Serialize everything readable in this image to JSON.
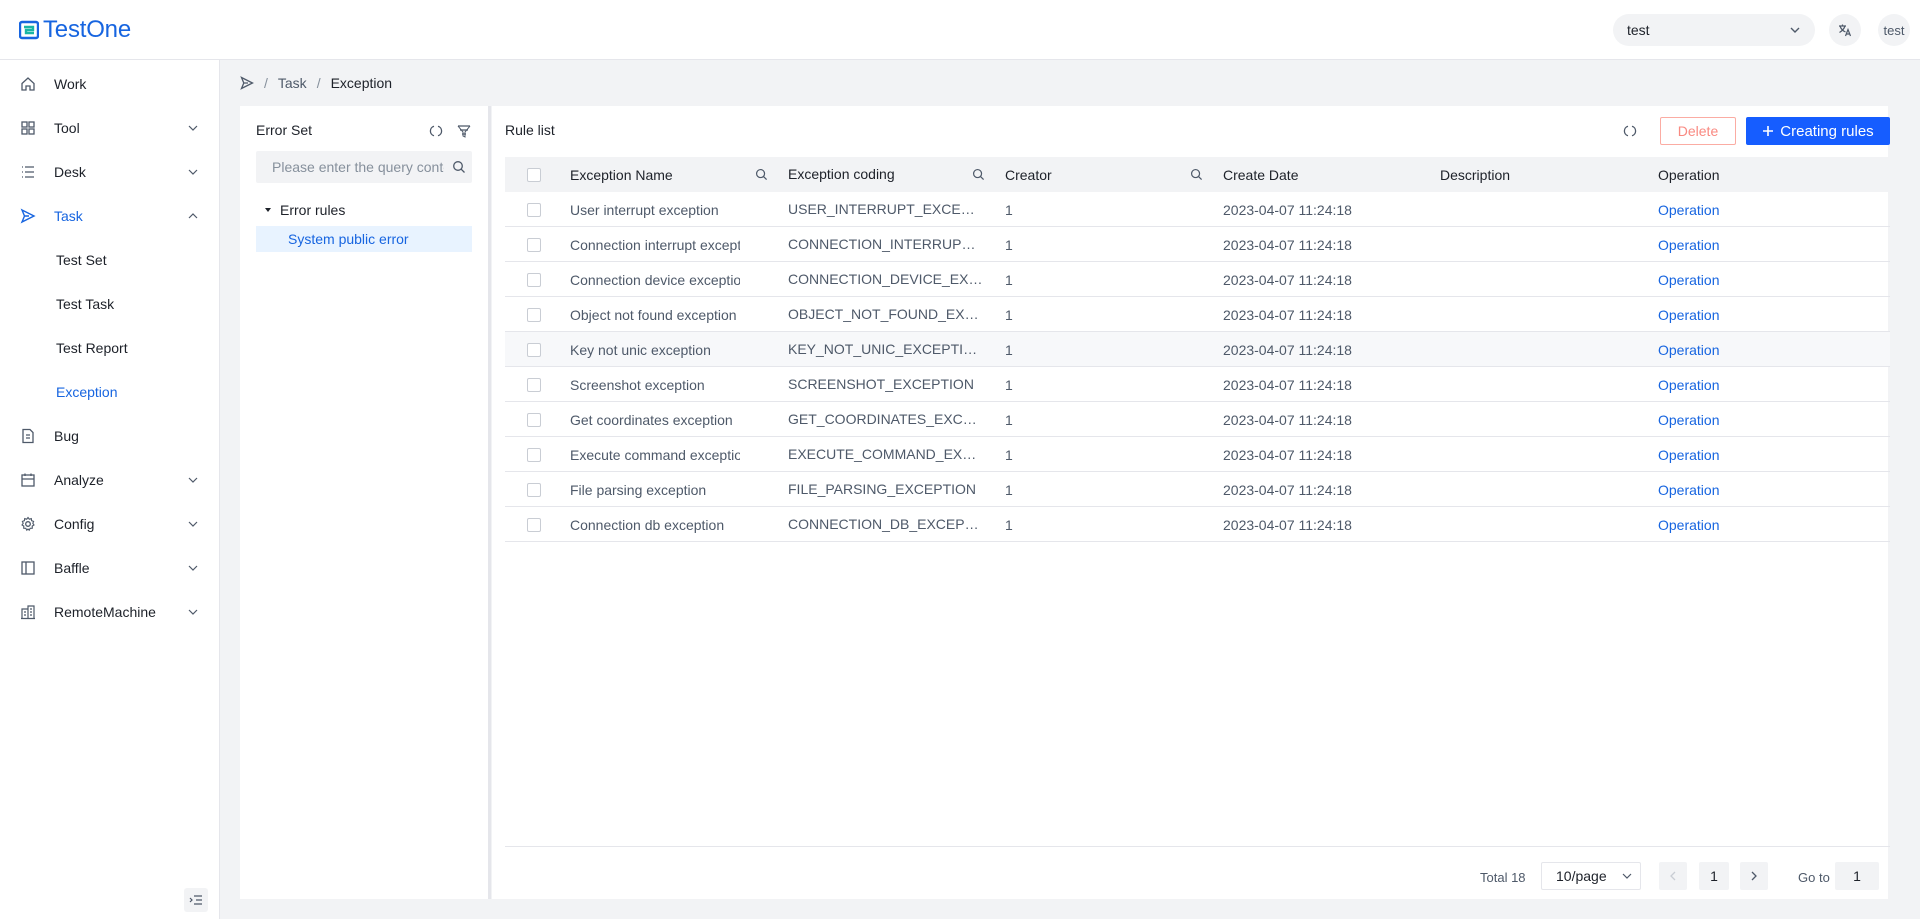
{
  "app": {
    "logo_text": "TestOne"
  },
  "topbar": {
    "project_value": "test",
    "lang_icon": "translate-icon",
    "user": "test"
  },
  "sidebar": {
    "items": [
      {
        "label": "Work",
        "icon": "home-icon"
      },
      {
        "label": "Tool",
        "icon": "grid-icon"
      },
      {
        "label": "Desk",
        "icon": "list-icon"
      },
      {
        "label": "Task",
        "icon": "send-icon"
      },
      {
        "label": "Bug",
        "icon": "document-icon"
      },
      {
        "label": "Analyze",
        "icon": "calendar-icon"
      },
      {
        "label": "Config",
        "icon": "gear-icon"
      },
      {
        "label": "Baffle",
        "icon": "layout-icon"
      },
      {
        "label": "RemoteMachine",
        "icon": "building-icon"
      }
    ],
    "task_children": [
      "Test Set",
      "Test Task",
      "Test Report",
      "Exception"
    ],
    "active_item": "Task",
    "selected_child": "Exception"
  },
  "breadcrumb": {
    "level1": "Task",
    "level2": "Exception"
  },
  "error_set": {
    "title": "Error Set",
    "search_placeholder": "Please enter the query content",
    "tree": {
      "root": "Error rules",
      "child": "System public error"
    }
  },
  "rule_list": {
    "title": "Rule list",
    "delete_label": "Delete",
    "create_label": "Creating rules",
    "columns": [
      "Exception Name",
      "Exception coding",
      "Creator",
      "Create Date",
      "Description",
      "Operation"
    ],
    "rows": [
      {
        "name": "User interrupt exception",
        "code": "USER_INTERRUPT_EXCEPTION",
        "creator": "1",
        "date": "2023-04-07 11:24:18",
        "description": "",
        "operation": "Operation"
      },
      {
        "name": "Connection interrupt exception",
        "code": "CONNECTION_INTERRUPT_EXCEPTION",
        "creator": "1",
        "date": "2023-04-07 11:24:18",
        "description": "",
        "operation": "Operation"
      },
      {
        "name": "Connection device exception",
        "code": "CONNECTION_DEVICE_EXCEPTION",
        "creator": "1",
        "date": "2023-04-07 11:24:18",
        "description": "",
        "operation": "Operation"
      },
      {
        "name": "Object not found exception",
        "code": "OBJECT_NOT_FOUND_EXCEPTION",
        "creator": "1",
        "date": "2023-04-07 11:24:18",
        "description": "",
        "operation": "Operation"
      },
      {
        "name": "Key not unic exception",
        "code": "KEY_NOT_UNIC_EXCEPTION",
        "creator": "1",
        "date": "2023-04-07 11:24:18",
        "description": "",
        "operation": "Operation"
      },
      {
        "name": "Screenshot exception",
        "code": "SCREENSHOT_EXCEPTION",
        "creator": "1",
        "date": "2023-04-07 11:24:18",
        "description": "",
        "operation": "Operation"
      },
      {
        "name": "Get coordinates exception",
        "code": "GET_COORDINATES_EXCEPTION",
        "creator": "1",
        "date": "2023-04-07 11:24:18",
        "description": "",
        "operation": "Operation"
      },
      {
        "name": "Execute command exception",
        "code": "EXECUTE_COMMAND_EXCEPTION",
        "creator": "1",
        "date": "2023-04-07 11:24:18",
        "description": "",
        "operation": "Operation"
      },
      {
        "name": "File parsing exception",
        "code": "FILE_PARSING_EXCEPTION",
        "creator": "1",
        "date": "2023-04-07 11:24:18",
        "description": "",
        "operation": "Operation"
      },
      {
        "name": "Connection db exception",
        "code": "CONNECTION_DB_EXCEPTION",
        "creator": "1",
        "date": "2023-04-07 11:24:18",
        "description": "",
        "operation": "Operation"
      }
    ]
  },
  "pagination": {
    "total_label": "Total 18",
    "page_size": "10/page",
    "current_page": "1",
    "goto_label": "Go to",
    "goto_value": "1"
  },
  "colors": {
    "primary": "#165DFF",
    "link": "#1765E0",
    "danger_text": "#F98981",
    "selected_bg": "#E8F3FF"
  }
}
